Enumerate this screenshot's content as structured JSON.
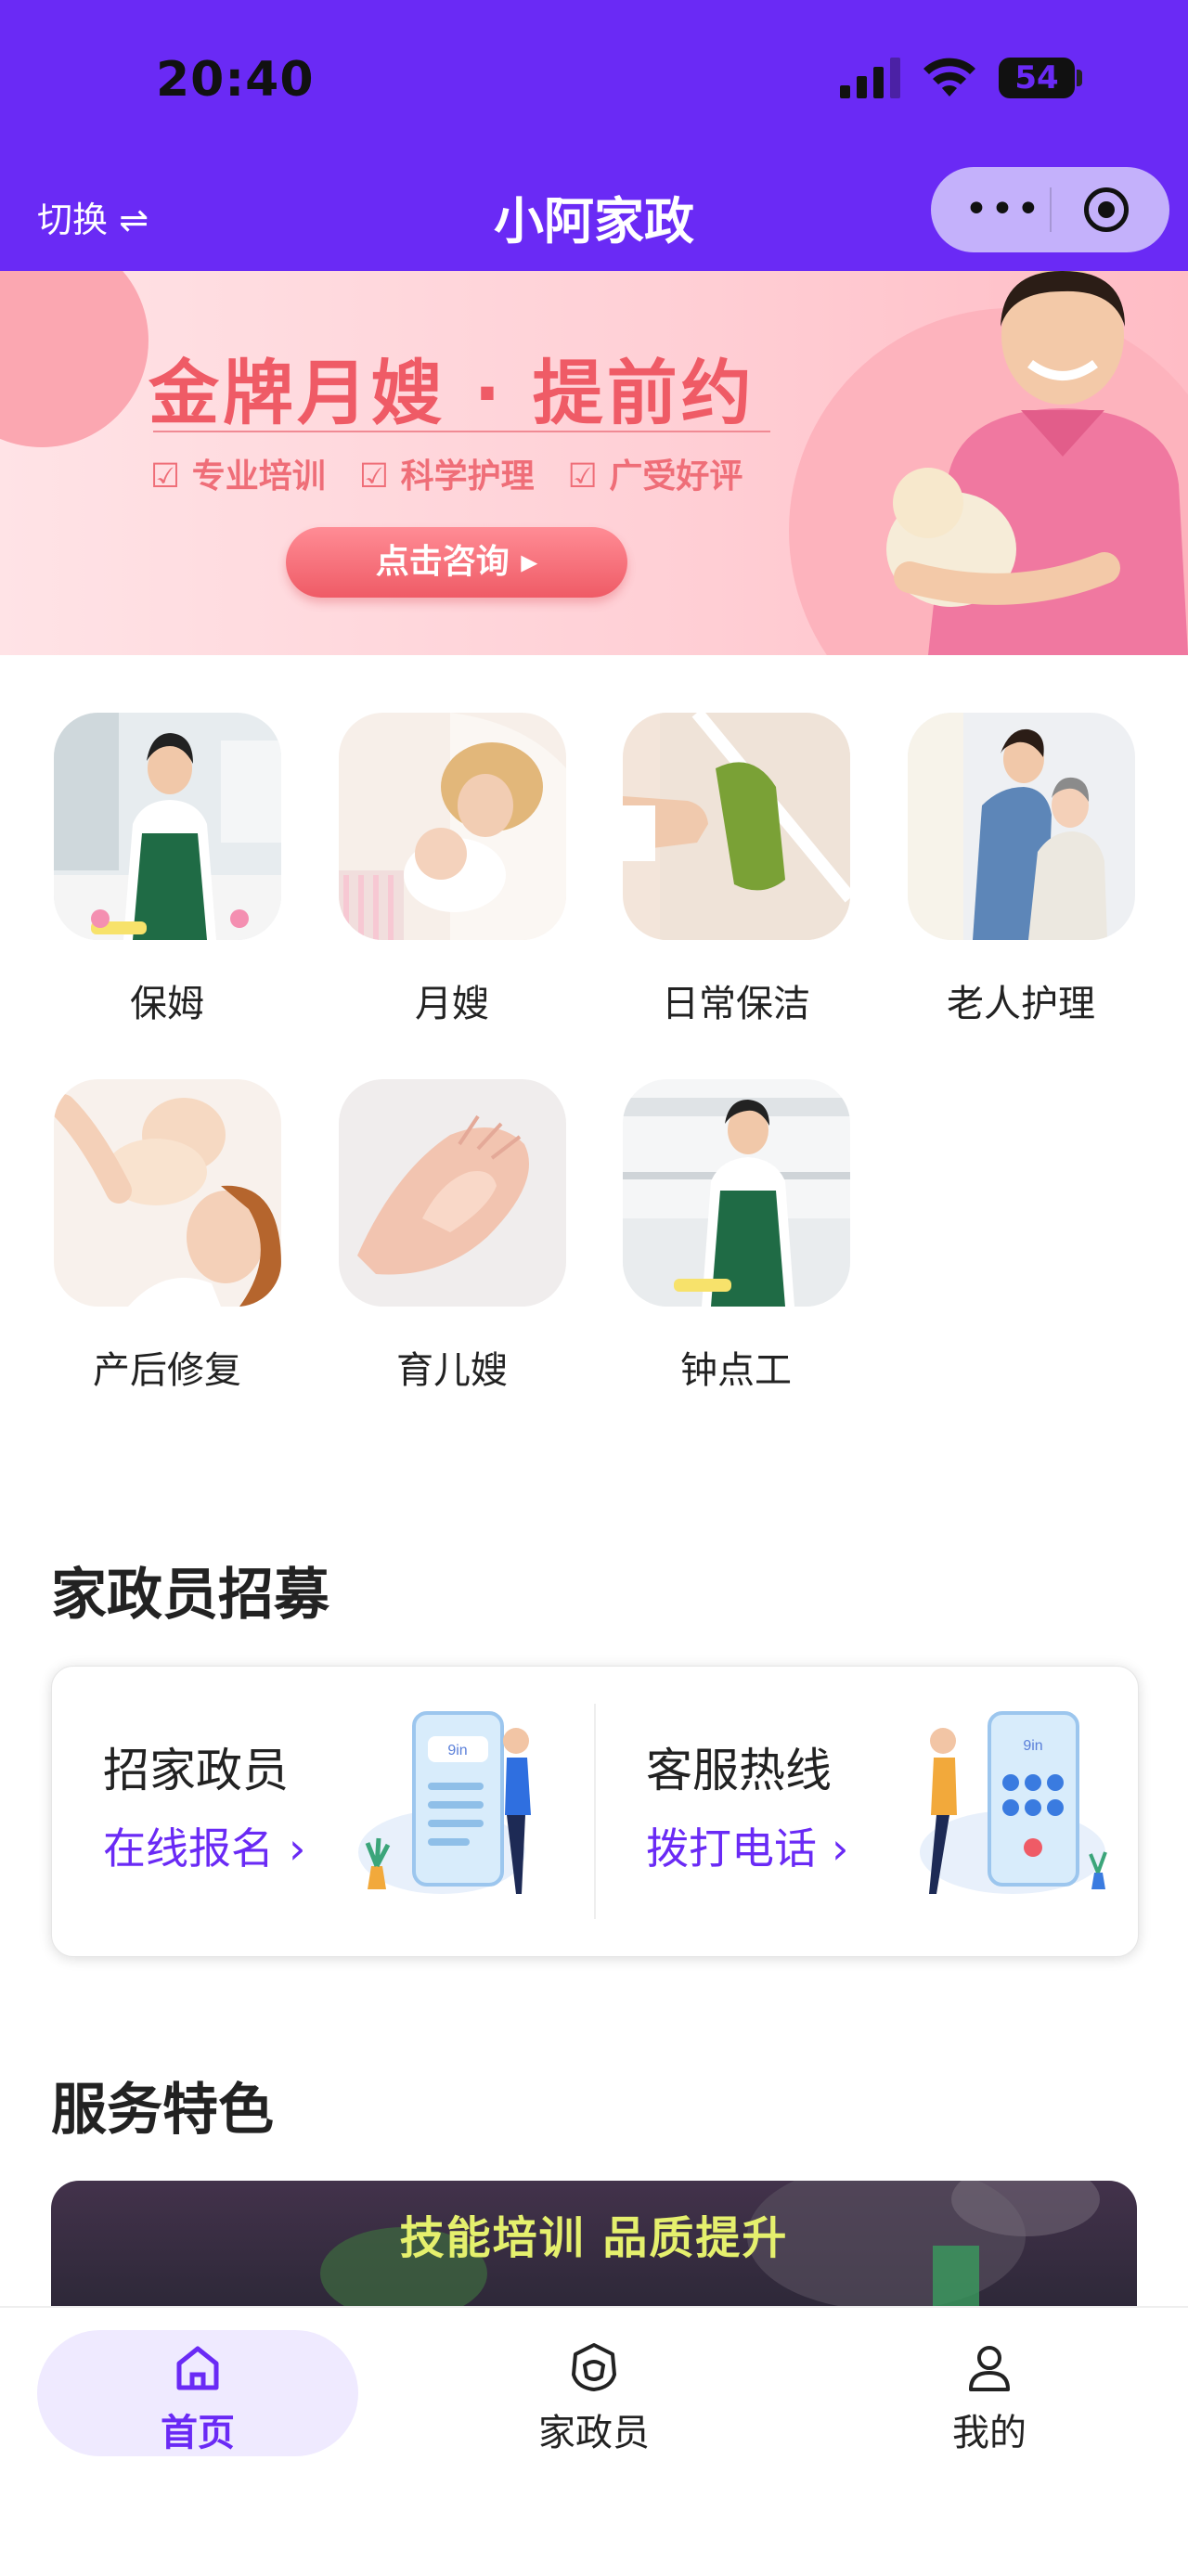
{
  "status_bar": {
    "time": "20:40",
    "battery": "54"
  },
  "navbar": {
    "switch_label": "切换 ⇌",
    "title": "小阿家政",
    "more_icon": "•••"
  },
  "banner": {
    "title": "金牌月嫂 · 提前约",
    "tags": [
      "☑ 专业培训",
      "☑ 科学护理",
      "☑ 广受好评"
    ],
    "button_label": "点击咨询 ▸"
  },
  "services": [
    {
      "label": "保姆",
      "icon": "nanny-photo"
    },
    {
      "label": "月嫂",
      "icon": "maternity-nurse-photo"
    },
    {
      "label": "日常保洁",
      "icon": "cleaning-photo"
    },
    {
      "label": "老人护理",
      "icon": "elderly-care-photo"
    },
    {
      "label": "产后修复",
      "icon": "postpartum-photo"
    },
    {
      "label": "育儿嫂",
      "icon": "childcare-photo"
    },
    {
      "label": "钟点工",
      "icon": "hourly-worker-photo"
    }
  ],
  "recruit": {
    "section_title": "家政员招募",
    "left": {
      "title": "招家政员",
      "link": "在线报名"
    },
    "right": {
      "title": "客服热线",
      "link": "拨打电话"
    }
  },
  "features": {
    "section_title": "服务特色",
    "banner_text": "技能培训  品质提升"
  },
  "tabbar": [
    {
      "label": "首页",
      "icon": "home-icon",
      "active": true
    },
    {
      "label": "家政员",
      "icon": "staff-icon",
      "active": false
    },
    {
      "label": "我的",
      "icon": "profile-icon",
      "active": false
    }
  ],
  "colors": {
    "brand": "#6a2af5",
    "banner_red": "#ef5b66",
    "feature_text": "#e5f06d"
  }
}
